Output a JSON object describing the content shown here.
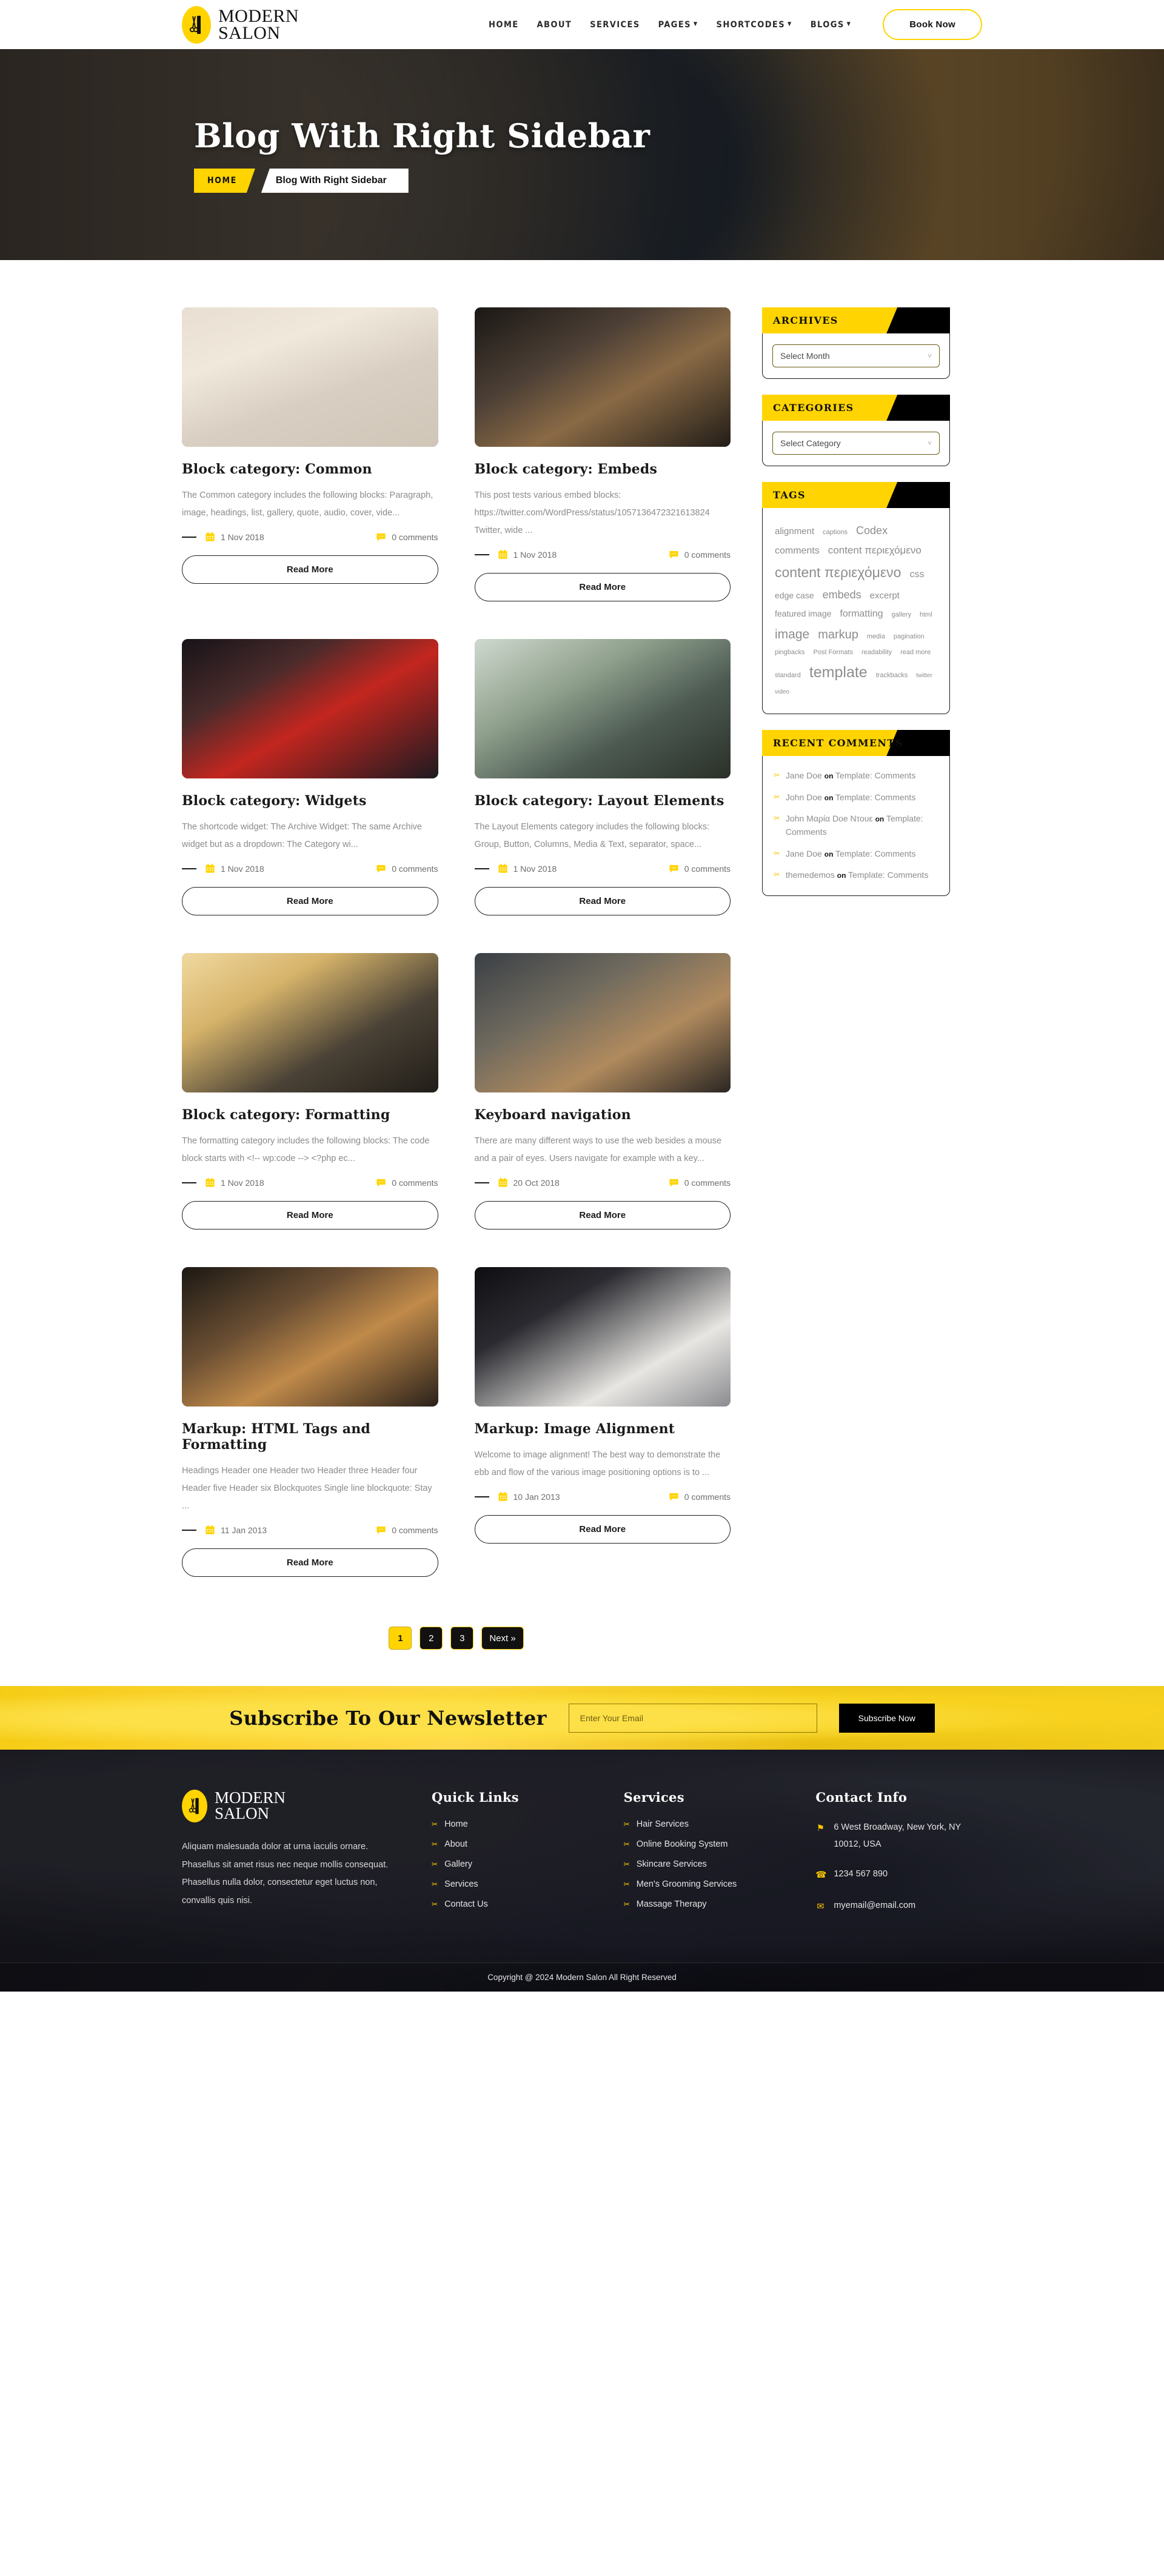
{
  "header": {
    "brand_line1": "MODERN",
    "brand_line2": "SALON",
    "nav": [
      {
        "label": "HOME",
        "caret": false
      },
      {
        "label": "ABOUT",
        "caret": false
      },
      {
        "label": "SERVICES",
        "caret": false
      },
      {
        "label": "PAGES",
        "caret": true
      },
      {
        "label": "SHORTCODES",
        "caret": true
      },
      {
        "label": "BLOGS",
        "caret": true
      }
    ],
    "book_button": "Book Now"
  },
  "hero": {
    "title": "Blog With Right Sidebar",
    "breadcrumb_home": "HOME",
    "breadcrumb_current": "Blog With Right Sidebar"
  },
  "posts": [
    {
      "title": "Block category: Common",
      "excerpt": "The Common category includes the following blocks: Paragraph, image, headings, list, gallery, quote, audio, cover, vide...",
      "date": "1 Nov 2018",
      "comments": "0 comments",
      "button": "Read More"
    },
    {
      "title": "Block category: Embeds",
      "excerpt": "This post tests various embed blocks: https://twitter.com/WordPress/status/1057136472321613824 Twitter, wide ...",
      "date": "1 Nov 2018",
      "comments": "0 comments",
      "button": "Read More"
    },
    {
      "title": "Block category: Widgets",
      "excerpt": "The shortcode widget: The Archive Widget: The same Archive widget but as a dropdown: The Category wi...",
      "date": "1 Nov 2018",
      "comments": "0 comments",
      "button": "Read More"
    },
    {
      "title": "Block category: Layout Elements",
      "excerpt": "The Layout Elements category includes the following blocks: Group, Button, Columns, Media & Text, separator, space...",
      "date": "1 Nov 2018",
      "comments": "0 comments",
      "button": "Read More"
    },
    {
      "title": "Block category: Formatting",
      "excerpt": "The formatting category includes the following blocks: The code block starts with <!-- wp:code --> <?php ec...",
      "date": "1 Nov 2018",
      "comments": "0 comments",
      "button": "Read More"
    },
    {
      "title": "Keyboard navigation",
      "excerpt": "There are many different ways to use the web besides a mouse and a pair of eyes. Users navigate for example with a key...",
      "date": "20 Oct 2018",
      "comments": "0 comments",
      "button": "Read More"
    },
    {
      "title": "Markup: HTML Tags and Formatting",
      "excerpt": "Headings Header one Header two Header three Header four Header five Header six Blockquotes Single line blockquote: Stay ...",
      "date": "11 Jan 2013",
      "comments": "0 comments",
      "button": "Read More"
    },
    {
      "title": "Markup: Image Alignment",
      "excerpt": "Welcome to image alignment! The best way to demonstrate the ebb and flow of the various image positioning options is to ...",
      "date": "10 Jan 2013",
      "comments": "0 comments",
      "button": "Read More"
    }
  ],
  "pagination": {
    "pages": [
      "1",
      "2",
      "3"
    ],
    "active": "1",
    "next": "Next »"
  },
  "sidebar": {
    "archives": {
      "title": "ARCHIVES",
      "select_value": "Select Month"
    },
    "categories": {
      "title": "CATEGORIES",
      "select_value": "Select Category"
    },
    "tags": {
      "title": "TAGS",
      "items": [
        {
          "label": "alignment",
          "size": 15
        },
        {
          "label": "captions",
          "size": 11
        },
        {
          "label": "Codex",
          "size": 18
        },
        {
          "label": "comments",
          "size": 16
        },
        {
          "label": "content περιεχόμενο",
          "size": 17
        },
        {
          "label": "content περιεχόμενο",
          "size": 23
        },
        {
          "label": "css",
          "size": 16
        },
        {
          "label": "edge case",
          "size": 14
        },
        {
          "label": "embeds",
          "size": 18
        },
        {
          "label": "excerpt",
          "size": 15
        },
        {
          "label": "featured image",
          "size": 14
        },
        {
          "label": "formatting",
          "size": 16
        },
        {
          "label": "gallery",
          "size": 11
        },
        {
          "label": "html",
          "size": 11
        },
        {
          "label": "image",
          "size": 21
        },
        {
          "label": "markup",
          "size": 20
        },
        {
          "label": "media",
          "size": 11
        },
        {
          "label": "pagination",
          "size": 11
        },
        {
          "label": "pingbacks",
          "size": 11
        },
        {
          "label": "Post Formats",
          "size": 11
        },
        {
          "label": "readability",
          "size": 11
        },
        {
          "label": "read more",
          "size": 11
        },
        {
          "label": "standard",
          "size": 11
        },
        {
          "label": "template",
          "size": 25
        },
        {
          "label": "trackbacks",
          "size": 11
        },
        {
          "label": "twitter",
          "size": 10
        },
        {
          "label": "video",
          "size": 10
        }
      ]
    },
    "recent_comments": {
      "title": "RECENT COMMENTS",
      "items": [
        {
          "author": "Jane Doe",
          "on": "on",
          "post": "Template: Comments"
        },
        {
          "author": "John Doe",
          "on": "on",
          "post": "Template: Comments"
        },
        {
          "author": "John Μαρία Doe Ντουε",
          "on": "on",
          "post": "Template: Comments"
        },
        {
          "author": "Jane Doe",
          "on": "on",
          "post": "Template: Comments"
        },
        {
          "author": "themedemos",
          "on": "on",
          "post": "Template: Comments"
        }
      ]
    }
  },
  "newsletter": {
    "title": "Subscribe To Our Newsletter",
    "placeholder": "Enter Your Email",
    "value": "",
    "button": "Subscribe Now"
  },
  "footer": {
    "brand_line1": "MODERN",
    "brand_line2": "SALON",
    "about": "Aliquam malesuada dolor at urna iaculis ornare. Phasellus sit amet risus nec neque mollis consequat. Phasellus nulla dolor, consectetur eget luctus non, convallis quis nisi.",
    "quick_links_title": "Quick Links",
    "quick_links": [
      "Home",
      "About",
      "Gallery",
      "Services",
      "Contact Us"
    ],
    "services_title": "Services",
    "services": [
      "Hair Services",
      "Online Booking System",
      "Skincare Services",
      "Men's Grooming Services",
      "Massage Therapy"
    ],
    "contact_title": "Contact Info",
    "contact": [
      {
        "icon": "location-pin-icon",
        "text": "6 West Broadway, New York, NY 10012, USA"
      },
      {
        "icon": "phone-icon",
        "text": "1234 567 890"
      },
      {
        "icon": "envelope-icon",
        "text": "myemail@email.com"
      }
    ],
    "copyright": "Copyright @ 2024 Modern Salon All Right Reserved"
  },
  "colors": {
    "accent": "#FFD400",
    "dark": "#111111",
    "muted": "#8d8d8d"
  }
}
